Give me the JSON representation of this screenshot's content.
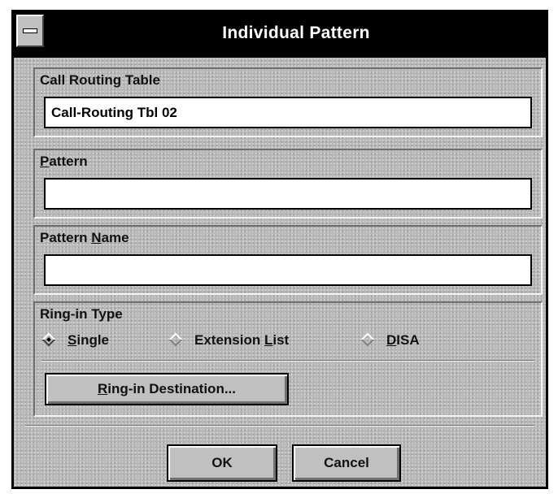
{
  "window": {
    "title": "Individual Pattern"
  },
  "call_routing_table": {
    "label": "Call Routing Table",
    "value": "Call-Routing Tbl 02"
  },
  "pattern": {
    "label_mnemonic": "P",
    "label_rest": "attern",
    "value": ""
  },
  "pattern_name": {
    "label_prefix": "Pattern ",
    "label_mnemonic": "N",
    "label_rest": "ame",
    "value": ""
  },
  "ring_in_type": {
    "label": "Ring-in Type",
    "options": [
      {
        "mnemonic": "S",
        "rest": "ingle",
        "prefix": "",
        "selected": true
      },
      {
        "prefix": "Extension ",
        "mnemonic": "L",
        "rest": "ist",
        "selected": false
      },
      {
        "prefix": "",
        "mnemonic": "D",
        "rest": "ISA",
        "selected": false
      }
    ],
    "destination_button": {
      "mnemonic": "R",
      "rest": "ing-in Destination..."
    }
  },
  "buttons": {
    "ok": "OK",
    "cancel": "Cancel"
  },
  "icons": {
    "system_menu": "system-menu-icon",
    "radio": "radio-diamond-icon"
  }
}
